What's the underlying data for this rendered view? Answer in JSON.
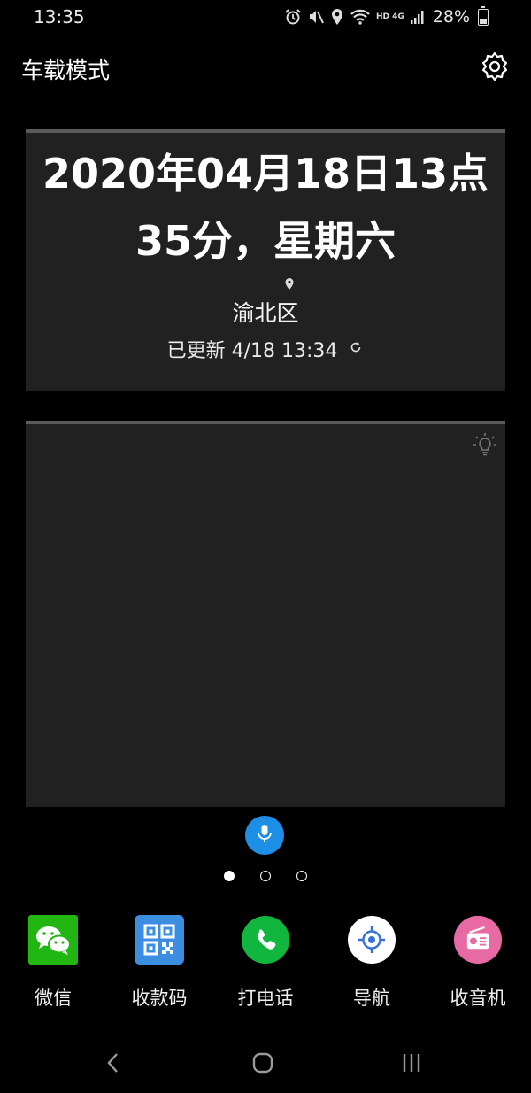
{
  "status_bar": {
    "time": "13:35",
    "network_label": "HD 4G",
    "battery_percent": "28%",
    "battery_level": 0.28,
    "icons": [
      "alarm-icon",
      "mute-icon",
      "location-icon",
      "wifi-icon",
      "signal-icon",
      "battery-icon"
    ]
  },
  "header": {
    "title": "车载模式",
    "settings_icon": "gear-icon"
  },
  "clock_card": {
    "line1": "2020年04月18日13点",
    "line2": "35分，星期六",
    "location": "渝北区",
    "updated": "已更新 4/18 13:34"
  },
  "blank_card": {
    "icon": "lightbulb-icon"
  },
  "voice": {
    "icon": "microphone-icon",
    "accent": "#1e8fe6"
  },
  "pager": {
    "count": 3,
    "active": 0
  },
  "dock": {
    "items": [
      {
        "label": "微信",
        "icon": "wechat-icon",
        "color": "#22b613"
      },
      {
        "label": "收款码",
        "icon": "qr-code-icon",
        "color": "#3b8ee0"
      },
      {
        "label": "打电话",
        "icon": "phone-icon",
        "color": "#10b63d"
      },
      {
        "label": "导航",
        "icon": "navigation-icon",
        "color": "#ffffff"
      },
      {
        "label": "收音机",
        "icon": "radio-icon",
        "color": "#e86aa3"
      }
    ]
  },
  "nav_bar": {
    "back_icon": "back-icon",
    "home_icon": "home-icon",
    "recents_icon": "recents-icon"
  }
}
